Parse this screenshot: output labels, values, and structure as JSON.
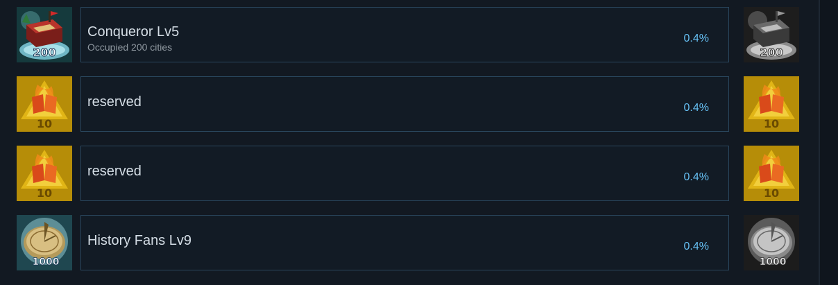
{
  "achievements": [
    {
      "title": "Conqueror Lv5",
      "description": "Occupied 200 cities",
      "percent": "0.4%",
      "icon_name": "conqueror-badge-icon",
      "icon_number": "200"
    },
    {
      "title": "reserved",
      "description": "",
      "percent": "0.4%",
      "icon_name": "fire-flag-badge-icon",
      "icon_number": "10"
    },
    {
      "title": "reserved",
      "description": "",
      "percent": "0.4%",
      "icon_name": "fire-flag-badge-icon",
      "icon_number": "10"
    },
    {
      "title": "History Fans Lv9",
      "description": "",
      "percent": "0.4%",
      "icon_name": "sundial-badge-icon",
      "icon_number": "1000"
    }
  ],
  "colors": {
    "background": "#121922",
    "card_border": "#2a475e",
    "title": "#d4dde5",
    "subtitle": "#8f98a0",
    "percent": "#66c0f4"
  }
}
